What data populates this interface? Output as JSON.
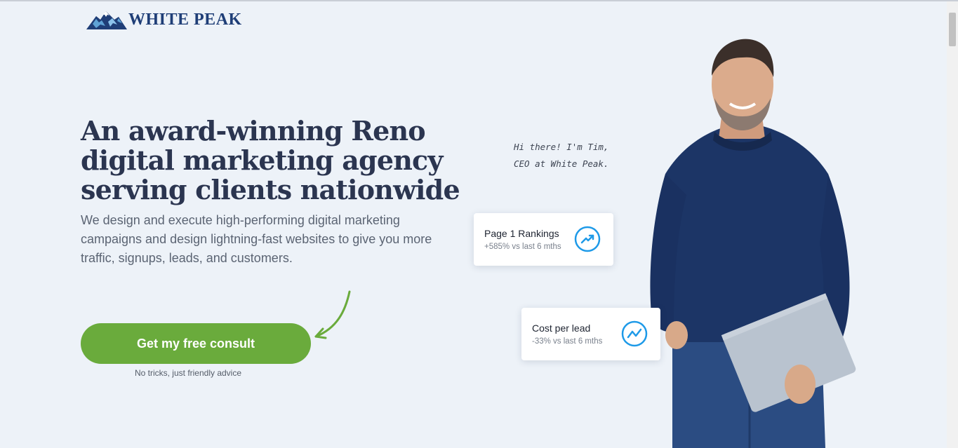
{
  "brand": {
    "name": "WHITE PEAK",
    "logo_icon": "mountain-icon",
    "color": "#1f3e77"
  },
  "hero": {
    "headline": "An award-winning Reno digital marketing agency serving clients nationwide",
    "subtext": "We design and execute high-performing digital marketing campaigns and design lightning-fast websites to give you more traffic, signups, leads, and customers.",
    "cta_label": "Get my free consult",
    "cta_note": "No tricks, just friendly advice",
    "cta_color": "#6aab3c"
  },
  "greeting": {
    "line1": "Hi there! I'm Tim,",
    "line2": "CEO at White Peak."
  },
  "stats": [
    {
      "title": "Page 1 Rankings",
      "subtitle": "+585% vs last 6 mths",
      "icon": "trending-up-icon"
    },
    {
      "title": "Cost per lead",
      "subtitle": "-33% vs last 6 mths",
      "icon": "trending-line-icon"
    }
  ],
  "accent_color": "#1e9ae8"
}
